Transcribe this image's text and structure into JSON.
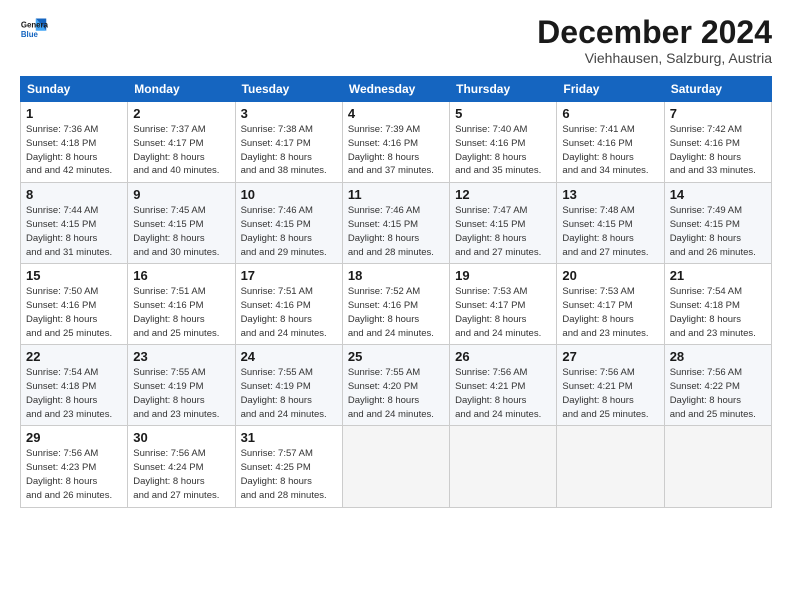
{
  "logo": {
    "line1": "General",
    "line2": "Blue"
  },
  "title": "December 2024",
  "location": "Viehhausen, Salzburg, Austria",
  "weekdays": [
    "Sunday",
    "Monday",
    "Tuesday",
    "Wednesday",
    "Thursday",
    "Friday",
    "Saturday"
  ],
  "weeks": [
    [
      {
        "day": "1",
        "sunrise": "7:36 AM",
        "sunset": "4:18 PM",
        "daylight": "8 hours and 42 minutes."
      },
      {
        "day": "2",
        "sunrise": "7:37 AM",
        "sunset": "4:17 PM",
        "daylight": "8 hours and 40 minutes."
      },
      {
        "day": "3",
        "sunrise": "7:38 AM",
        "sunset": "4:17 PM",
        "daylight": "8 hours and 38 minutes."
      },
      {
        "day": "4",
        "sunrise": "7:39 AM",
        "sunset": "4:16 PM",
        "daylight": "8 hours and 37 minutes."
      },
      {
        "day": "5",
        "sunrise": "7:40 AM",
        "sunset": "4:16 PM",
        "daylight": "8 hours and 35 minutes."
      },
      {
        "day": "6",
        "sunrise": "7:41 AM",
        "sunset": "4:16 PM",
        "daylight": "8 hours and 34 minutes."
      },
      {
        "day": "7",
        "sunrise": "7:42 AM",
        "sunset": "4:16 PM",
        "daylight": "8 hours and 33 minutes."
      }
    ],
    [
      {
        "day": "8",
        "sunrise": "7:44 AM",
        "sunset": "4:15 PM",
        "daylight": "8 hours and 31 minutes."
      },
      {
        "day": "9",
        "sunrise": "7:45 AM",
        "sunset": "4:15 PM",
        "daylight": "8 hours and 30 minutes."
      },
      {
        "day": "10",
        "sunrise": "7:46 AM",
        "sunset": "4:15 PM",
        "daylight": "8 hours and 29 minutes."
      },
      {
        "day": "11",
        "sunrise": "7:46 AM",
        "sunset": "4:15 PM",
        "daylight": "8 hours and 28 minutes."
      },
      {
        "day": "12",
        "sunrise": "7:47 AM",
        "sunset": "4:15 PM",
        "daylight": "8 hours and 27 minutes."
      },
      {
        "day": "13",
        "sunrise": "7:48 AM",
        "sunset": "4:15 PM",
        "daylight": "8 hours and 27 minutes."
      },
      {
        "day": "14",
        "sunrise": "7:49 AM",
        "sunset": "4:15 PM",
        "daylight": "8 hours and 26 minutes."
      }
    ],
    [
      {
        "day": "15",
        "sunrise": "7:50 AM",
        "sunset": "4:16 PM",
        "daylight": "8 hours and 25 minutes."
      },
      {
        "day": "16",
        "sunrise": "7:51 AM",
        "sunset": "4:16 PM",
        "daylight": "8 hours and 25 minutes."
      },
      {
        "day": "17",
        "sunrise": "7:51 AM",
        "sunset": "4:16 PM",
        "daylight": "8 hours and 24 minutes."
      },
      {
        "day": "18",
        "sunrise": "7:52 AM",
        "sunset": "4:16 PM",
        "daylight": "8 hours and 24 minutes."
      },
      {
        "day": "19",
        "sunrise": "7:53 AM",
        "sunset": "4:17 PM",
        "daylight": "8 hours and 24 minutes."
      },
      {
        "day": "20",
        "sunrise": "7:53 AM",
        "sunset": "4:17 PM",
        "daylight": "8 hours and 23 minutes."
      },
      {
        "day": "21",
        "sunrise": "7:54 AM",
        "sunset": "4:18 PM",
        "daylight": "8 hours and 23 minutes."
      }
    ],
    [
      {
        "day": "22",
        "sunrise": "7:54 AM",
        "sunset": "4:18 PM",
        "daylight": "8 hours and 23 minutes."
      },
      {
        "day": "23",
        "sunrise": "7:55 AM",
        "sunset": "4:19 PM",
        "daylight": "8 hours and 23 minutes."
      },
      {
        "day": "24",
        "sunrise": "7:55 AM",
        "sunset": "4:19 PM",
        "daylight": "8 hours and 24 minutes."
      },
      {
        "day": "25",
        "sunrise": "7:55 AM",
        "sunset": "4:20 PM",
        "daylight": "8 hours and 24 minutes."
      },
      {
        "day": "26",
        "sunrise": "7:56 AM",
        "sunset": "4:21 PM",
        "daylight": "8 hours and 24 minutes."
      },
      {
        "day": "27",
        "sunrise": "7:56 AM",
        "sunset": "4:21 PM",
        "daylight": "8 hours and 25 minutes."
      },
      {
        "day": "28",
        "sunrise": "7:56 AM",
        "sunset": "4:22 PM",
        "daylight": "8 hours and 25 minutes."
      }
    ],
    [
      {
        "day": "29",
        "sunrise": "7:56 AM",
        "sunset": "4:23 PM",
        "daylight": "8 hours and 26 minutes."
      },
      {
        "day": "30",
        "sunrise": "7:56 AM",
        "sunset": "4:24 PM",
        "daylight": "8 hours and 27 minutes."
      },
      {
        "day": "31",
        "sunrise": "7:57 AM",
        "sunset": "4:25 PM",
        "daylight": "8 hours and 28 minutes."
      },
      null,
      null,
      null,
      null
    ]
  ],
  "labels": {
    "sunrise": "Sunrise:",
    "sunset": "Sunset:",
    "daylight": "Daylight:"
  }
}
